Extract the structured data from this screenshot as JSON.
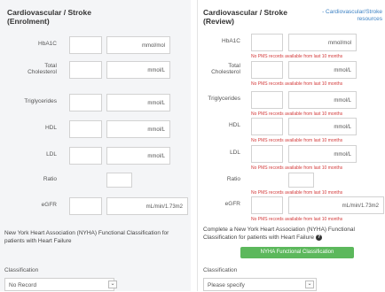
{
  "enrolment": {
    "title": "Cardiovascular / Stroke\n(Enrolment)",
    "fields": [
      {
        "label": "HbA1C",
        "unit": "mmol/mol"
      },
      {
        "label": "Total\nCholesterol",
        "unit": "mmol/L"
      },
      {
        "label": "Triglycerides",
        "unit": "mmol/L"
      },
      {
        "label": "HDL",
        "unit": "mmol/L"
      },
      {
        "label": "LDL",
        "unit": "mmol/L"
      },
      {
        "label": "Ratio",
        "unit": ""
      },
      {
        "label": "eGFR",
        "unit": "mL/min/1.73m2"
      }
    ],
    "nyha_text": "New York Heart Association (NYHA) Functional Classification for patients with Heart Failure",
    "classification_label": "Classification",
    "classification_value": "No Record"
  },
  "review": {
    "title": "Cardiovascular / Stroke\n(Review)",
    "resources_link": "- Cardiovascular/Stroke\nresources",
    "fields": [
      {
        "label": "HbA1C",
        "unit": "mmol/mol",
        "error": "No PMS records available from last 10 months"
      },
      {
        "label": "Total\nCholesterol",
        "unit": "mmol/L",
        "error": "No PMS records available from last 10 months"
      },
      {
        "label": "Triglycerides",
        "unit": "mmol/L",
        "error": "No PMS records available from last 10 months"
      },
      {
        "label": "HDL",
        "unit": "mmol/L",
        "error": "No PMS records available from last 10 months"
      },
      {
        "label": "LDL",
        "unit": "mmol/L",
        "error": "No PMS records available from last 10 months"
      },
      {
        "label": "Ratio",
        "unit": "",
        "error": "No PMS records available from last 10 months"
      },
      {
        "label": "eGFR",
        "unit": "mL/min/1.73m2",
        "error": "No PMS records available from last 10 months"
      }
    ],
    "nyha_text": "Complete a New York Heart Association (NYHA) Functional Classification for patients with Heart Failure",
    "help_icon": "question-circle-icon",
    "button_label": "NYHA Functional Classification",
    "classification_label": "Classification",
    "classification_value": "Please specify"
  },
  "colors": {
    "error": "#d33a3a",
    "button": "#5cb85c",
    "link": "#3d82c4"
  }
}
